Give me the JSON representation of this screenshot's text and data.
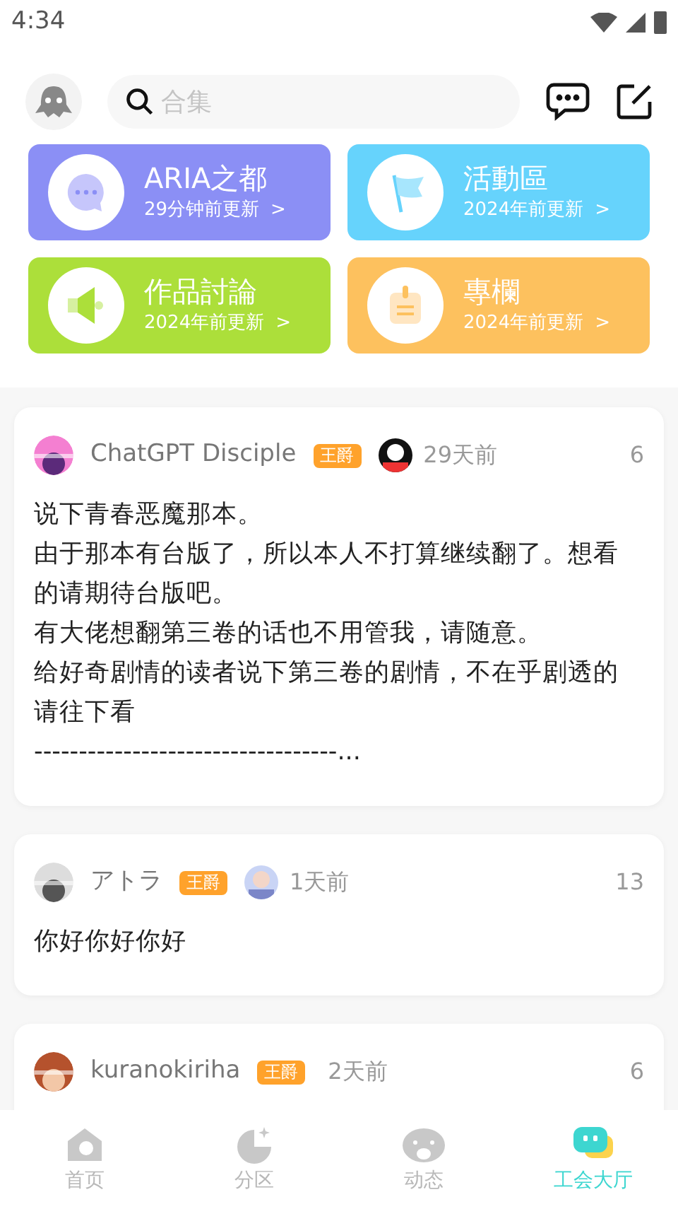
{
  "status_bar": {
    "time": "4:34"
  },
  "search": {
    "placeholder": "合集"
  },
  "sections": [
    {
      "kind": "chat",
      "title": "ARIA之都",
      "updated": "29分钟前更新",
      "chevron": ">",
      "color": "#8b8ff5"
    },
    {
      "kind": "flag",
      "title": "活動區",
      "updated": "2024年前更新",
      "chevron": ">",
      "color": "#66d3fc"
    },
    {
      "kind": "speaker",
      "title": "作品討論",
      "updated": "2024年前更新",
      "chevron": ">",
      "color": "#acdf3a"
    },
    {
      "kind": "note",
      "title": "專欄",
      "updated": "2024年前更新",
      "chevron": ">",
      "color": "#fdc15e"
    }
  ],
  "posts": [
    {
      "author": "ChatGPT Disciple",
      "badge": "王爵",
      "has_extra_avatar": true,
      "time": "29天前",
      "count": "6",
      "body": [
        "说下青春恶魔那本。",
        "由于那本有台版了，所以本人不打算继续翻了。想看的请期待台版吧。",
        "有大佬想翻第三卷的话也不用管我，请随意。",
        "给好奇剧情的读者说下第三卷的剧情，不在乎剧透的请往下看",
        "----------------------------------..."
      ]
    },
    {
      "author": "アトラ",
      "badge": "王爵",
      "has_extra_avatar": true,
      "time": "1天前",
      "count": "13",
      "body": [
        "你好你好你好"
      ]
    },
    {
      "author": "kuranokiriha",
      "badge": "王爵",
      "has_extra_avatar": false,
      "time": "2天前",
      "count": "6"
    }
  ],
  "bottom_nav": [
    {
      "kind": "home",
      "label": "首页",
      "selected": false
    },
    {
      "kind": "moon",
      "label": "分区",
      "selected": false
    },
    {
      "kind": "face",
      "label": "动态",
      "selected": false
    },
    {
      "kind": "chat",
      "label": "工会大厅",
      "selected": true
    }
  ]
}
